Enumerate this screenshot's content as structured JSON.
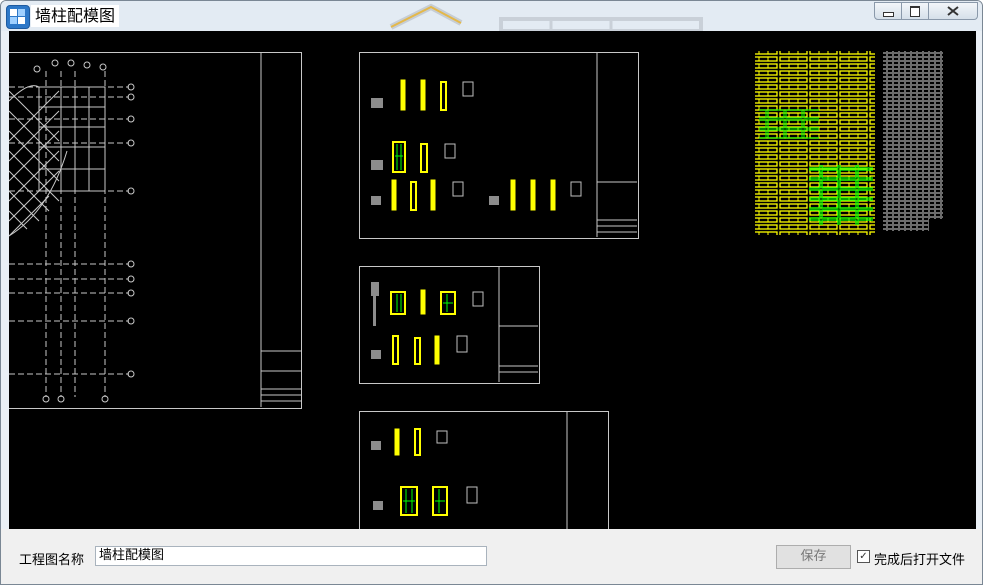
{
  "window": {
    "title": "墙柱配模图"
  },
  "titlebar": {
    "controls": [
      "minimize-icon",
      "restore-icon",
      "close-icon"
    ]
  },
  "canvas": {
    "background": "#000000",
    "line_colors": {
      "frame": "#c8c8c8",
      "panel": "#ffff00",
      "panel_alt": "#00ff00"
    }
  },
  "footer": {
    "name_label": "工程图名称",
    "name_value": "墙柱配模图",
    "save_label": "保存",
    "open_after_checked": true,
    "open_after_label": "完成后打开文件"
  }
}
